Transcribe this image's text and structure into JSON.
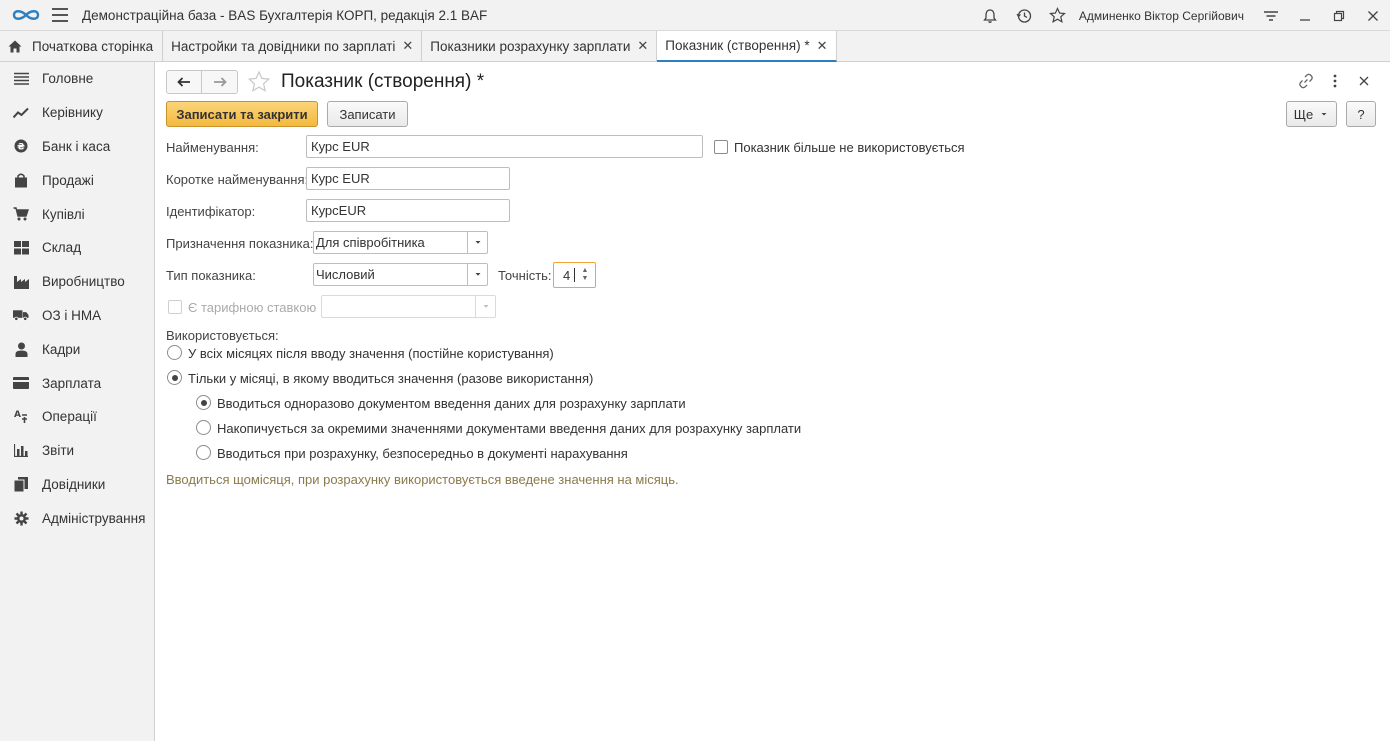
{
  "app": {
    "title": "Демонстраційна база - BAS Бухгалтерія КОРП, редакція 2.1 BAF",
    "user": "Админенко Віктор Сергійович"
  },
  "tabs": [
    {
      "label": "Початкова сторінка"
    },
    {
      "label": "Настройки та довідники по зарплаті"
    },
    {
      "label": "Показники розрахунку зарплати"
    },
    {
      "label": "Показник (створення) *"
    }
  ],
  "sidebar": {
    "items": [
      {
        "label": "Головне",
        "icon": "list-icon"
      },
      {
        "label": "Керівнику",
        "icon": "trend-icon"
      },
      {
        "label": "Банк і каса",
        "icon": "coin-icon"
      },
      {
        "label": "Продажі",
        "icon": "bag-icon"
      },
      {
        "label": "Купівлі",
        "icon": "cart-icon"
      },
      {
        "label": "Склад",
        "icon": "warehouse-icon"
      },
      {
        "label": "Виробництво",
        "icon": "factory-icon"
      },
      {
        "label": "ОЗ і НМА",
        "icon": "truck-icon"
      },
      {
        "label": "Кадри",
        "icon": "person-icon"
      },
      {
        "label": "Зарплата",
        "icon": "card-icon"
      },
      {
        "label": "Операції",
        "icon": "operations-icon"
      },
      {
        "label": "Звіти",
        "icon": "bar-chart-icon"
      },
      {
        "label": "Довідники",
        "icon": "books-icon"
      },
      {
        "label": "Адміністрування",
        "icon": "gear-icon"
      }
    ]
  },
  "form": {
    "title": "Показник (створення) *",
    "save_close_label": "Записати та закрити",
    "save_label": "Записати",
    "more_label": "Ще",
    "help_label": "?",
    "name_label": "Найменування:",
    "name_value": "Курс EUR",
    "unused_label": "Показник більше не використовується",
    "short_name_label": "Коротке найменування:",
    "short_name_value": "Курс EUR",
    "id_label": "Ідентифікатор:",
    "id_value": "КурсEUR",
    "purpose_label": "Призначення показника:",
    "purpose_value": "Для співробітника",
    "type_label": "Тип показника:",
    "type_value": "Числовий",
    "precision_label": "Точність:",
    "precision_value": "4",
    "tariff_label": "Є тарифною ставкою",
    "tariff_value": "",
    "used_label": "Використовується:",
    "usage_options": [
      "У всіх місяцях після вводу значення (постійне користування)",
      "Тільки у місяці, в якому вводиться значення (разове використання)"
    ],
    "input_options": [
      "Вводиться одноразово документом введення даних для розрахунку зарплати",
      "Накопичується за окремими значеннями документами введення даних для розрахунку зарплати",
      "Вводиться при розрахунку, безпосередньо в документі нарахування"
    ],
    "hint": "Вводиться щомісяця, при розрахунку використовується введене значення на місяць."
  }
}
